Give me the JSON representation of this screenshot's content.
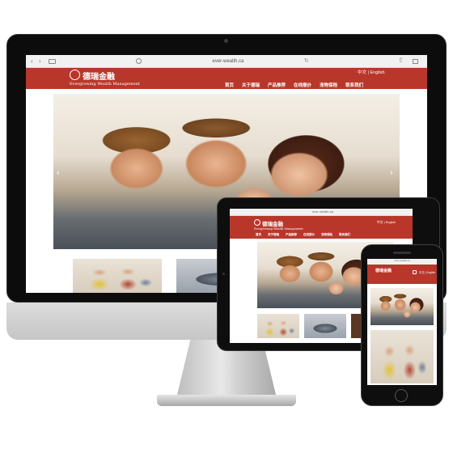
{
  "browser": {
    "url": "ever-wealth.ca",
    "back": "‹",
    "forward": "›",
    "reload": "↻",
    "share": "⇧"
  },
  "site": {
    "logo_text": "德瑞金融",
    "tagline": "Evergrowing Wealth Management",
    "language_switch": "中文 | English",
    "nav": [
      "首页",
      "关于德瑞",
      "产品推荐",
      "在线报价",
      "宠物保险",
      "联系我们"
    ],
    "brand_color": "#b8372a",
    "hero_prev": "‹",
    "hero_next": "›"
  },
  "icons": {
    "logo": "logo-seal-icon",
    "menu": "menu-icon",
    "shield": "shield-icon",
    "sidebar": "sidebar-icon",
    "tabs": "tabs-icon"
  }
}
